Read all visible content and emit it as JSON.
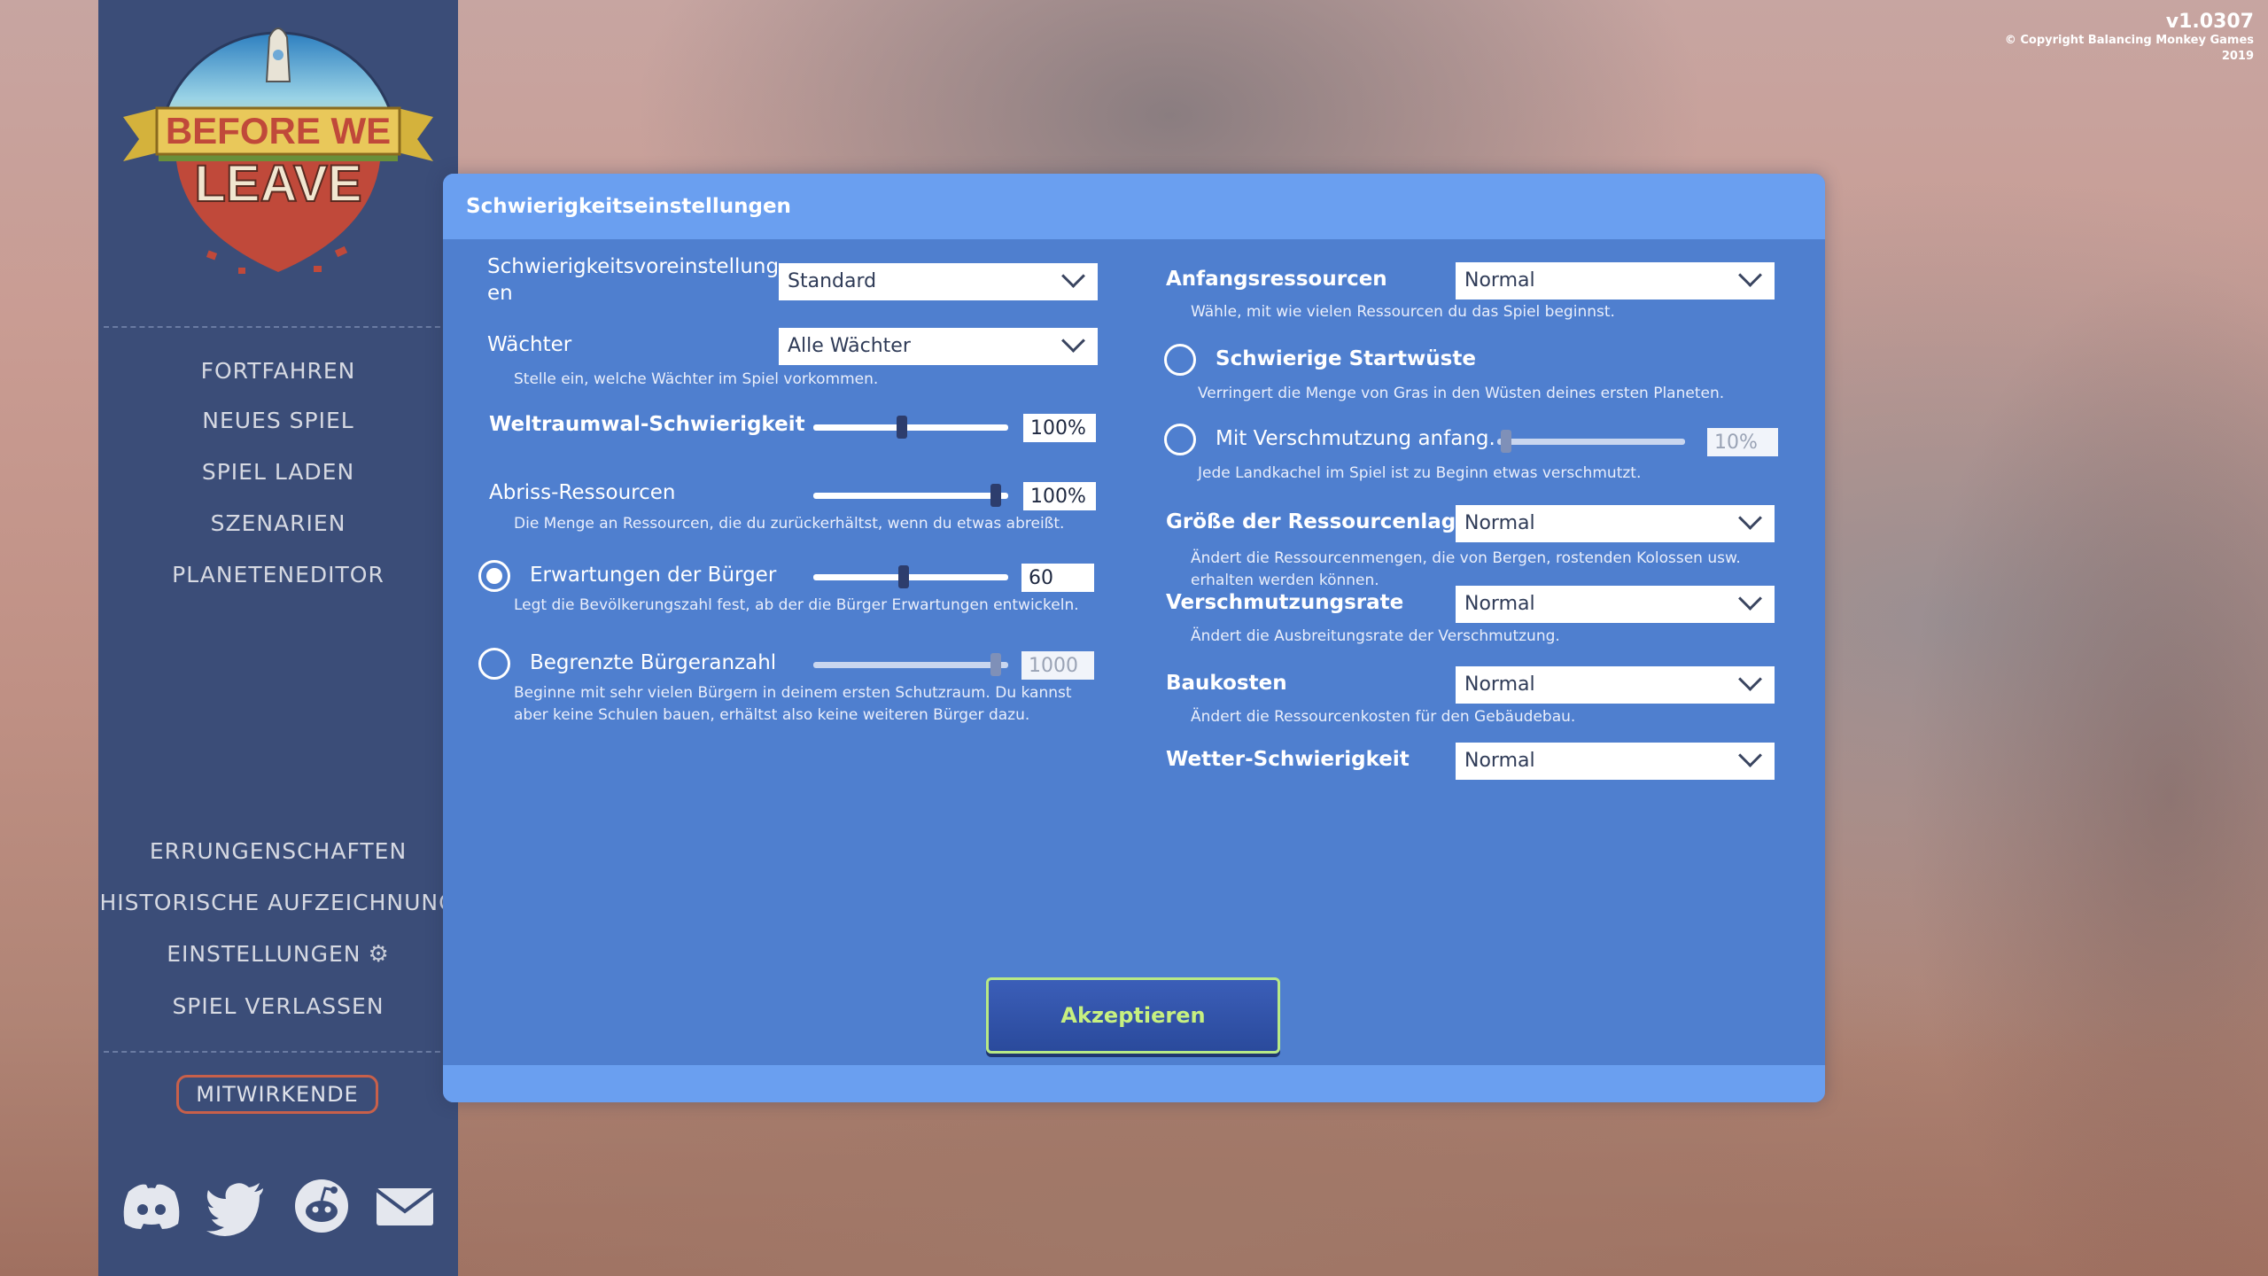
{
  "version": {
    "number": "v1.0307",
    "copyright_line1": "© Copyright Balancing Monkey Games",
    "copyright_line2": "2019"
  },
  "logo": {
    "line1": "BEFORE WE",
    "line2": "LEAVE"
  },
  "sidebar": {
    "main_menu": [
      "FORTFAHREN",
      "NEUES SPIEL",
      "SPIEL LADEN",
      "SZENARIEN",
      "PLANETENEDITOR"
    ],
    "bottom_menu": [
      "ERRUNGENSCHAFTEN",
      "HISTORISCHE AUFZEICHNUNG",
      "EINSTELLUNGEN",
      "SPIEL VERLASSEN"
    ],
    "credits": "MITWIRKENDE",
    "social_icons": [
      "discord-icon",
      "twitter-icon",
      "reddit-icon",
      "mail-icon"
    ]
  },
  "dialog": {
    "title": "Schwierigkeitseinstellungen",
    "left": {
      "preset": {
        "label_line1": "Schwierigkeitsvoreinstellung",
        "label_line2": "en",
        "value": "Standard"
      },
      "guardians": {
        "label": "Wächter",
        "value": "Alle Wächter",
        "desc": "Stelle ein, welche Wächter im Spiel vorkommen."
      },
      "space_whale": {
        "label": "Weltraumwal-Schwierigkeit",
        "value": "100%",
        "level": 0.45
      },
      "demolish": {
        "label": "Abriss-Ressourcen",
        "value": "100%",
        "level": 0.96,
        "desc": "Die Menge an Ressourcen, die du zurückerhältst, wenn du etwas abreißt."
      },
      "expectations": {
        "label": "Erwartungen der Bürger",
        "value": "60",
        "level": 0.46,
        "checked": true,
        "desc": "Legt die Bevölkerungszahl fest, ab der die Bürger Erwartungen entwickeln."
      },
      "limited_citizens": {
        "label": "Begrenzte Bürgeranzahl",
        "value": "1000",
        "level": 0.96,
        "checked": false,
        "desc_line1": "Beginne mit sehr vielen Bürgern in deinem ersten Schutzraum. Du kannst",
        "desc_line2": "aber keine Schulen bauen, erhältst also keine weiteren Bürger dazu."
      }
    },
    "right": {
      "start_resources": {
        "label": "Anfangsressourcen",
        "value": "Normal",
        "desc": "Wähle, mit wie vielen Ressourcen du das Spiel beginnst."
      },
      "hard_desert": {
        "label": "Schwierige Startwüste",
        "checked": false,
        "desc": "Verringert die Menge von Gras in den Wüsten deines ersten Planeten."
      },
      "pollution_start": {
        "label": "Mit Verschmutzung anfang.",
        "checked": false,
        "value": "10%",
        "level": 0.02,
        "desc": "Jede Landkachel im Spiel ist zu Beginn etwas verschmutzt."
      },
      "deposit_size": {
        "label": "Größe der Ressourcenlager",
        "value": "Normal",
        "desc_line1": "Ändert die Ressourcenmengen, die von Bergen, rostenden Kolossen usw.",
        "desc_line2": "erhalten werden können."
      },
      "pollution_rate": {
        "label": "Verschmutzungsrate",
        "value": "Normal",
        "desc": "Ändert die Ausbreitungsrate der Verschmutzung."
      },
      "build_cost": {
        "label": "Baukosten",
        "value": "Normal",
        "desc": "Ändert die Ressourcenkosten für den Gebäudebau."
      },
      "weather": {
        "label": "Wetter-Schwierigkeit",
        "value": "Normal"
      }
    },
    "accept": "Akzeptieren"
  }
}
